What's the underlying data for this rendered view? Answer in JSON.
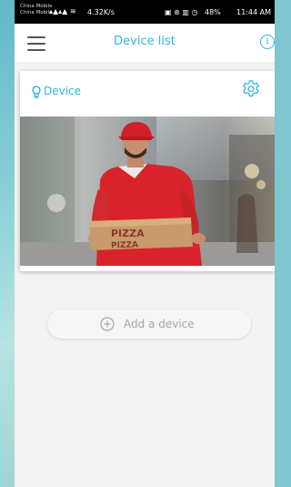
{
  "status_bar": {
    "carrier_1": "China Mobile",
    "carrier_2": "China Mobile",
    "network_speed": "4.32K/s",
    "battery": "48%",
    "time": "11:44 AM"
  },
  "app_bar": {
    "title": "Device list",
    "menu_icon": "hamburger-menu-icon",
    "info_icon": "info-icon"
  },
  "device_card": {
    "name": "Device",
    "name_icon": "bulb-icon",
    "settings_icon": "gear-icon",
    "preview": "camera-snapshot"
  },
  "add_device": {
    "label": "Add a device",
    "icon": "plus-circle-icon"
  },
  "colors": {
    "accent": "#2fb3e6",
    "background": "#f2f2f2",
    "add_label": "#a5a5a5"
  }
}
